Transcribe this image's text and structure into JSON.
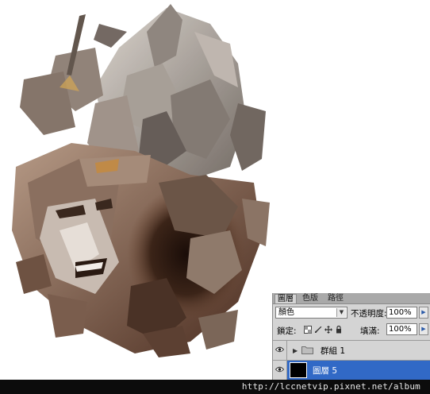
{
  "colors": {
    "panel_bg": "#d4d4d4",
    "tab_strip": "#a9a9a9",
    "selected_layer": "#3169c6",
    "watermark_bg": "#0c0c0c"
  },
  "layers_panel": {
    "tabs": [
      {
        "label": "圖層",
        "active": true
      },
      {
        "label": "色版",
        "active": false
      },
      {
        "label": "路徑",
        "active": false
      }
    ],
    "blend_mode": "顏色",
    "opacity_label": "不透明度:",
    "opacity_value": "100%",
    "lock_label": "鎖定:",
    "fill_label": "填滿:",
    "fill_value": "100%",
    "layers": [
      {
        "name": "群組 1",
        "type": "group",
        "visible": true,
        "selected": false
      },
      {
        "name": "圖層 5",
        "type": "layer",
        "visible": true,
        "selected": true
      }
    ]
  },
  "watermark": "http://lccnetvip.pixnet.net/album"
}
